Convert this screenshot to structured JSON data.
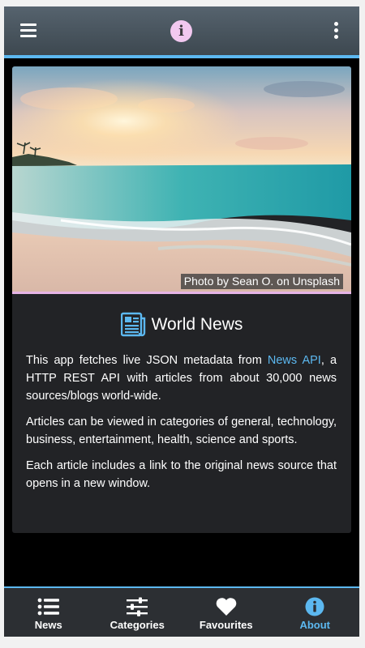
{
  "header": {
    "menu_icon": "hamburger-menu-icon",
    "center_icon": "info-icon",
    "center_icon_glyph": "i",
    "overflow_icon": "vertical-dots-icon",
    "accent_color": "#5cb8f0",
    "info_badge_color": "#f2c8f0"
  },
  "hero": {
    "image": "beach-sunset-photo",
    "caption": "Photo by Sean O. on Unsplash"
  },
  "about": {
    "title_icon": "newspaper-icon",
    "title": "World News",
    "p1_before": "This app fetches live JSON metadata from ",
    "p1_link": "News API",
    "p1_after": ", a HTTP REST API with articles from about 30,000 news sources/blogs world-wide.",
    "p2": "Articles can be viewed in categories of general, technology, business, entertainment, health, science and sports.",
    "p3": "Each article includes a link to the original news source that opens in a new window."
  },
  "tabs": [
    {
      "label": "News",
      "icon": "list-icon",
      "active": false
    },
    {
      "label": "Categories",
      "icon": "sliders-icon",
      "active": false
    },
    {
      "label": "Favourites",
      "icon": "heart-icon",
      "active": false
    },
    {
      "label": "About",
      "icon": "info-icon",
      "active": true
    }
  ]
}
